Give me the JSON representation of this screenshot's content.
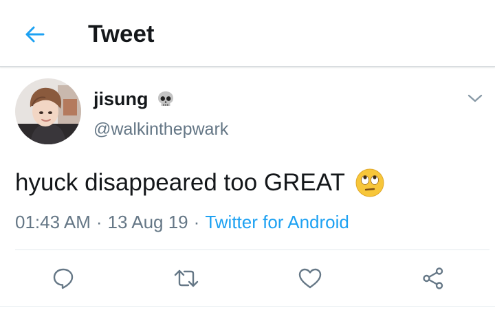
{
  "header": {
    "title": "Tweet",
    "back_icon": "arrow-left-icon",
    "accent": "#1da1f2"
  },
  "tweet": {
    "author": {
      "display_name": "jisung",
      "name_emoji": "skull-emoji",
      "handle": "@walkinthepwark"
    },
    "text": "hyuck disappeared too GREAT",
    "text_emoji": "face-with-rolling-eyes-emoji",
    "time": "01:43 AM",
    "date": "13 Aug 19",
    "separator": "·",
    "source": "Twitter for Android"
  },
  "actions": [
    {
      "name": "reply",
      "icon": "reply-icon"
    },
    {
      "name": "retweet",
      "icon": "retweet-icon"
    },
    {
      "name": "like",
      "icon": "heart-icon"
    },
    {
      "name": "share",
      "icon": "share-icon"
    }
  ],
  "colors": {
    "text_primary": "#14171a",
    "text_secondary": "#657786",
    "link": "#1da1f2",
    "icon": "#657786"
  }
}
